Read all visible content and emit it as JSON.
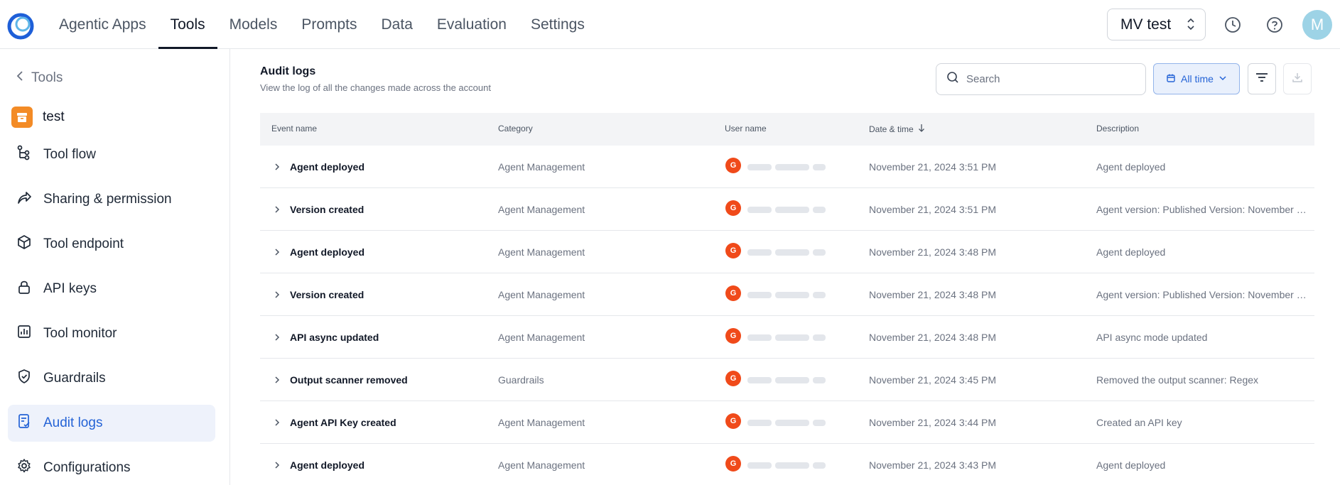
{
  "colors": {
    "accent": "#2463d6",
    "active_bg": "#eef2fb",
    "tool_badge": "#f38b26",
    "user_avatar": "#f04a1a",
    "top_avatar": "#9dd3e6"
  },
  "topnav": {
    "items": [
      {
        "label": "Agentic Apps"
      },
      {
        "label": "Tools",
        "active": true
      },
      {
        "label": "Models"
      },
      {
        "label": "Prompts"
      },
      {
        "label": "Data"
      },
      {
        "label": "Evaluation"
      },
      {
        "label": "Settings"
      }
    ],
    "project": "MV test",
    "avatar_letter": "M",
    "icons": [
      "history-icon",
      "help-icon"
    ]
  },
  "sidebar": {
    "back_label": "Tools",
    "tool_name": "test",
    "items": [
      {
        "label": "Tool flow",
        "icon": "flow-icon"
      },
      {
        "label": "Sharing & permission",
        "icon": "share-icon"
      },
      {
        "label": "Tool endpoint",
        "icon": "cube-icon"
      },
      {
        "label": "API keys",
        "icon": "lock-icon"
      },
      {
        "label": "Tool monitor",
        "icon": "chart-icon"
      },
      {
        "label": "Guardrails",
        "icon": "shield-icon"
      },
      {
        "label": "Audit logs",
        "icon": "audit-icon",
        "active": true
      },
      {
        "label": "Configurations",
        "icon": "gear-icon"
      }
    ]
  },
  "main": {
    "title": "Audit logs",
    "subtitle": "View the log of all the changes made across the account",
    "search_placeholder": "Search",
    "time_filter": "All time",
    "columns": [
      "Event name",
      "Category",
      "User name",
      "Date & time",
      "Description"
    ],
    "rows": [
      {
        "event": "Agent deployed",
        "category": "Agent Management",
        "avatar": "G",
        "date": "November 21, 2024 3:51 PM",
        "description": "Agent deployed"
      },
      {
        "event": "Version created",
        "category": "Agent Management",
        "avatar": "G",
        "date": "November 21, 2024 3:51 PM",
        "description": "Agent version: Published Version: November 2..."
      },
      {
        "event": "Agent deployed",
        "category": "Agent Management",
        "avatar": "G",
        "date": "November 21, 2024 3:48 PM",
        "description": "Agent deployed"
      },
      {
        "event": "Version created",
        "category": "Agent Management",
        "avatar": "G",
        "date": "November 21, 2024 3:48 PM",
        "description": "Agent version: Published Version: November 2..."
      },
      {
        "event": "API async updated",
        "category": "Agent Management",
        "avatar": "G",
        "date": "November 21, 2024 3:48 PM",
        "description": "API async mode updated"
      },
      {
        "event": "Output scanner removed",
        "category": "Guardrails",
        "avatar": "G",
        "date": "November 21, 2024 3:45 PM",
        "description": "Removed the output scanner: Regex"
      },
      {
        "event": "Agent API Key created",
        "category": "Agent Management",
        "avatar": "G",
        "date": "November 21, 2024 3:44 PM",
        "description": "Created an API key"
      },
      {
        "event": "Agent deployed",
        "category": "Agent Management",
        "avatar": "G",
        "date": "November 21, 2024 3:43 PM",
        "description": "Agent deployed"
      }
    ]
  }
}
